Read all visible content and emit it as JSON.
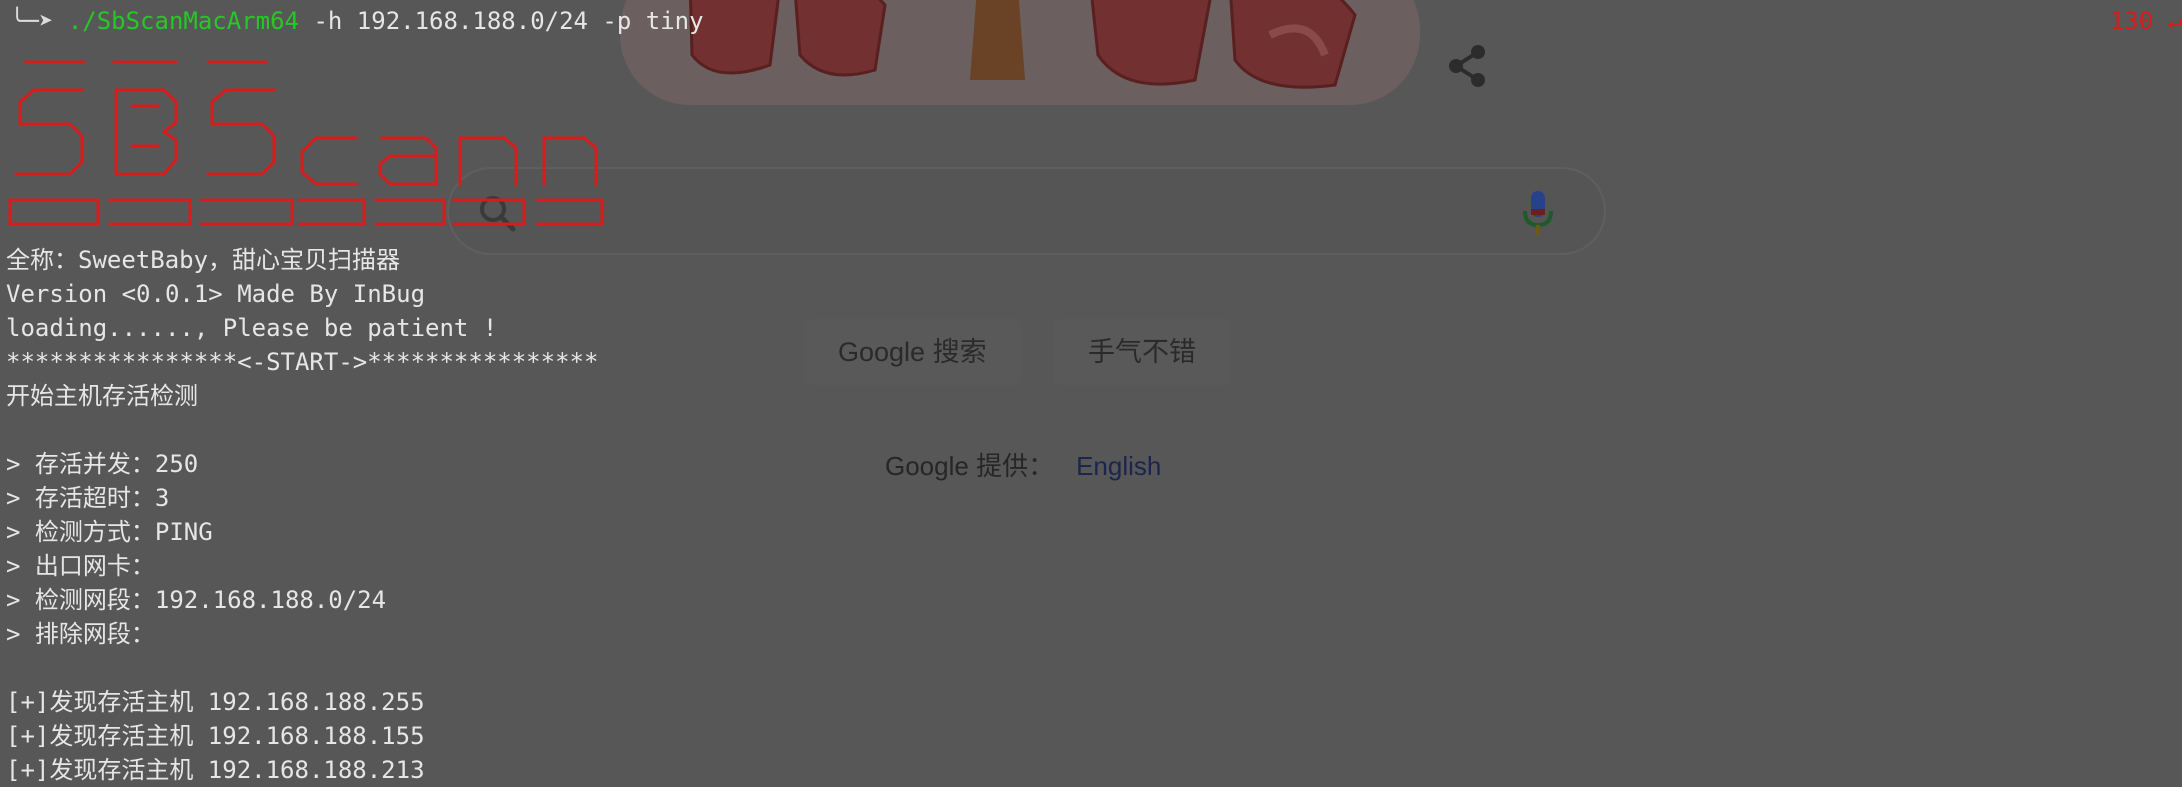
{
  "terminal": {
    "prompt_arrow": "╰─➤",
    "command": "./SbScanMacArm64",
    "args": " -h 192.168.188.0/24 -p tiny",
    "exit_code": "130 ↵",
    "banner_color": "#d81c1c",
    "command_color": "#26c826",
    "lines": [
      "全称：SweetBaby，甜心宝贝扫描器",
      "Version <0.0.1> Made By InBug",
      "loading......, Please be patient !",
      "****************<-START->****************",
      "开始主机存活检测",
      "",
      "> 存活并发：250",
      "> 存活超时：3",
      "> 检测方式：PING",
      "> 出口网卡：",
      "> 检测网段：192.168.188.0/24",
      "> 排除网段：",
      "",
      "[+]发现存活主机 192.168.188.255",
      "[+]发现存活主机 192.168.188.155",
      "[+]发现存活主机 192.168.188.213"
    ]
  },
  "background": {
    "search_button": "Google 搜索",
    "lucky_button": "手气不错",
    "offered_in": "Google 提供：",
    "language_link": "English",
    "icons": [
      "share-icon",
      "search-icon",
      "mic-icon"
    ]
  }
}
